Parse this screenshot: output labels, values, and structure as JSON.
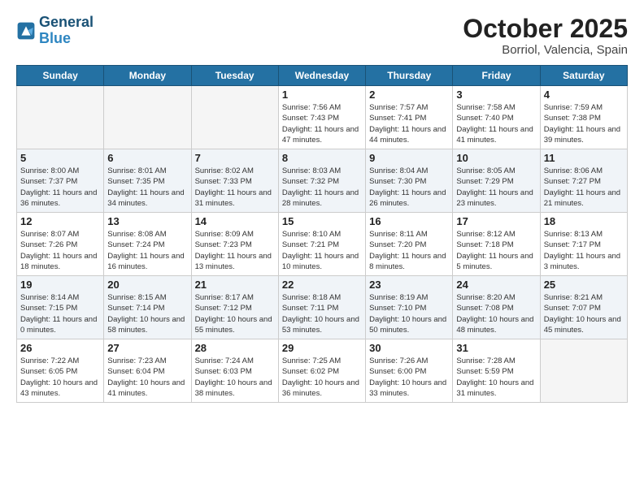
{
  "header": {
    "logo_line1": "General",
    "logo_line2": "Blue",
    "month": "October 2025",
    "location": "Borriol, Valencia, Spain"
  },
  "weekdays": [
    "Sunday",
    "Monday",
    "Tuesday",
    "Wednesday",
    "Thursday",
    "Friday",
    "Saturday"
  ],
  "weeks": [
    [
      {
        "day": "",
        "sunrise": "",
        "sunset": "",
        "daylight": ""
      },
      {
        "day": "",
        "sunrise": "",
        "sunset": "",
        "daylight": ""
      },
      {
        "day": "",
        "sunrise": "",
        "sunset": "",
        "daylight": ""
      },
      {
        "day": "1",
        "sunrise": "Sunrise: 7:56 AM",
        "sunset": "Sunset: 7:43 PM",
        "daylight": "Daylight: 11 hours and 47 minutes."
      },
      {
        "day": "2",
        "sunrise": "Sunrise: 7:57 AM",
        "sunset": "Sunset: 7:41 PM",
        "daylight": "Daylight: 11 hours and 44 minutes."
      },
      {
        "day": "3",
        "sunrise": "Sunrise: 7:58 AM",
        "sunset": "Sunset: 7:40 PM",
        "daylight": "Daylight: 11 hours and 41 minutes."
      },
      {
        "day": "4",
        "sunrise": "Sunrise: 7:59 AM",
        "sunset": "Sunset: 7:38 PM",
        "daylight": "Daylight: 11 hours and 39 minutes."
      }
    ],
    [
      {
        "day": "5",
        "sunrise": "Sunrise: 8:00 AM",
        "sunset": "Sunset: 7:37 PM",
        "daylight": "Daylight: 11 hours and 36 minutes."
      },
      {
        "day": "6",
        "sunrise": "Sunrise: 8:01 AM",
        "sunset": "Sunset: 7:35 PM",
        "daylight": "Daylight: 11 hours and 34 minutes."
      },
      {
        "day": "7",
        "sunrise": "Sunrise: 8:02 AM",
        "sunset": "Sunset: 7:33 PM",
        "daylight": "Daylight: 11 hours and 31 minutes."
      },
      {
        "day": "8",
        "sunrise": "Sunrise: 8:03 AM",
        "sunset": "Sunset: 7:32 PM",
        "daylight": "Daylight: 11 hours and 28 minutes."
      },
      {
        "day": "9",
        "sunrise": "Sunrise: 8:04 AM",
        "sunset": "Sunset: 7:30 PM",
        "daylight": "Daylight: 11 hours and 26 minutes."
      },
      {
        "day": "10",
        "sunrise": "Sunrise: 8:05 AM",
        "sunset": "Sunset: 7:29 PM",
        "daylight": "Daylight: 11 hours and 23 minutes."
      },
      {
        "day": "11",
        "sunrise": "Sunrise: 8:06 AM",
        "sunset": "Sunset: 7:27 PM",
        "daylight": "Daylight: 11 hours and 21 minutes."
      }
    ],
    [
      {
        "day": "12",
        "sunrise": "Sunrise: 8:07 AM",
        "sunset": "Sunset: 7:26 PM",
        "daylight": "Daylight: 11 hours and 18 minutes."
      },
      {
        "day": "13",
        "sunrise": "Sunrise: 8:08 AM",
        "sunset": "Sunset: 7:24 PM",
        "daylight": "Daylight: 11 hours and 16 minutes."
      },
      {
        "day": "14",
        "sunrise": "Sunrise: 8:09 AM",
        "sunset": "Sunset: 7:23 PM",
        "daylight": "Daylight: 11 hours and 13 minutes."
      },
      {
        "day": "15",
        "sunrise": "Sunrise: 8:10 AM",
        "sunset": "Sunset: 7:21 PM",
        "daylight": "Daylight: 11 hours and 10 minutes."
      },
      {
        "day": "16",
        "sunrise": "Sunrise: 8:11 AM",
        "sunset": "Sunset: 7:20 PM",
        "daylight": "Daylight: 11 hours and 8 minutes."
      },
      {
        "day": "17",
        "sunrise": "Sunrise: 8:12 AM",
        "sunset": "Sunset: 7:18 PM",
        "daylight": "Daylight: 11 hours and 5 minutes."
      },
      {
        "day": "18",
        "sunrise": "Sunrise: 8:13 AM",
        "sunset": "Sunset: 7:17 PM",
        "daylight": "Daylight: 11 hours and 3 minutes."
      }
    ],
    [
      {
        "day": "19",
        "sunrise": "Sunrise: 8:14 AM",
        "sunset": "Sunset: 7:15 PM",
        "daylight": "Daylight: 11 hours and 0 minutes."
      },
      {
        "day": "20",
        "sunrise": "Sunrise: 8:15 AM",
        "sunset": "Sunset: 7:14 PM",
        "daylight": "Daylight: 10 hours and 58 minutes."
      },
      {
        "day": "21",
        "sunrise": "Sunrise: 8:17 AM",
        "sunset": "Sunset: 7:12 PM",
        "daylight": "Daylight: 10 hours and 55 minutes."
      },
      {
        "day": "22",
        "sunrise": "Sunrise: 8:18 AM",
        "sunset": "Sunset: 7:11 PM",
        "daylight": "Daylight: 10 hours and 53 minutes."
      },
      {
        "day": "23",
        "sunrise": "Sunrise: 8:19 AM",
        "sunset": "Sunset: 7:10 PM",
        "daylight": "Daylight: 10 hours and 50 minutes."
      },
      {
        "day": "24",
        "sunrise": "Sunrise: 8:20 AM",
        "sunset": "Sunset: 7:08 PM",
        "daylight": "Daylight: 10 hours and 48 minutes."
      },
      {
        "day": "25",
        "sunrise": "Sunrise: 8:21 AM",
        "sunset": "Sunset: 7:07 PM",
        "daylight": "Daylight: 10 hours and 45 minutes."
      }
    ],
    [
      {
        "day": "26",
        "sunrise": "Sunrise: 7:22 AM",
        "sunset": "Sunset: 6:05 PM",
        "daylight": "Daylight: 10 hours and 43 minutes."
      },
      {
        "day": "27",
        "sunrise": "Sunrise: 7:23 AM",
        "sunset": "Sunset: 6:04 PM",
        "daylight": "Daylight: 10 hours and 41 minutes."
      },
      {
        "day": "28",
        "sunrise": "Sunrise: 7:24 AM",
        "sunset": "Sunset: 6:03 PM",
        "daylight": "Daylight: 10 hours and 38 minutes."
      },
      {
        "day": "29",
        "sunrise": "Sunrise: 7:25 AM",
        "sunset": "Sunset: 6:02 PM",
        "daylight": "Daylight: 10 hours and 36 minutes."
      },
      {
        "day": "30",
        "sunrise": "Sunrise: 7:26 AM",
        "sunset": "Sunset: 6:00 PM",
        "daylight": "Daylight: 10 hours and 33 minutes."
      },
      {
        "day": "31",
        "sunrise": "Sunrise: 7:28 AM",
        "sunset": "Sunset: 5:59 PM",
        "daylight": "Daylight: 10 hours and 31 minutes."
      },
      {
        "day": "",
        "sunrise": "",
        "sunset": "",
        "daylight": ""
      }
    ]
  ]
}
